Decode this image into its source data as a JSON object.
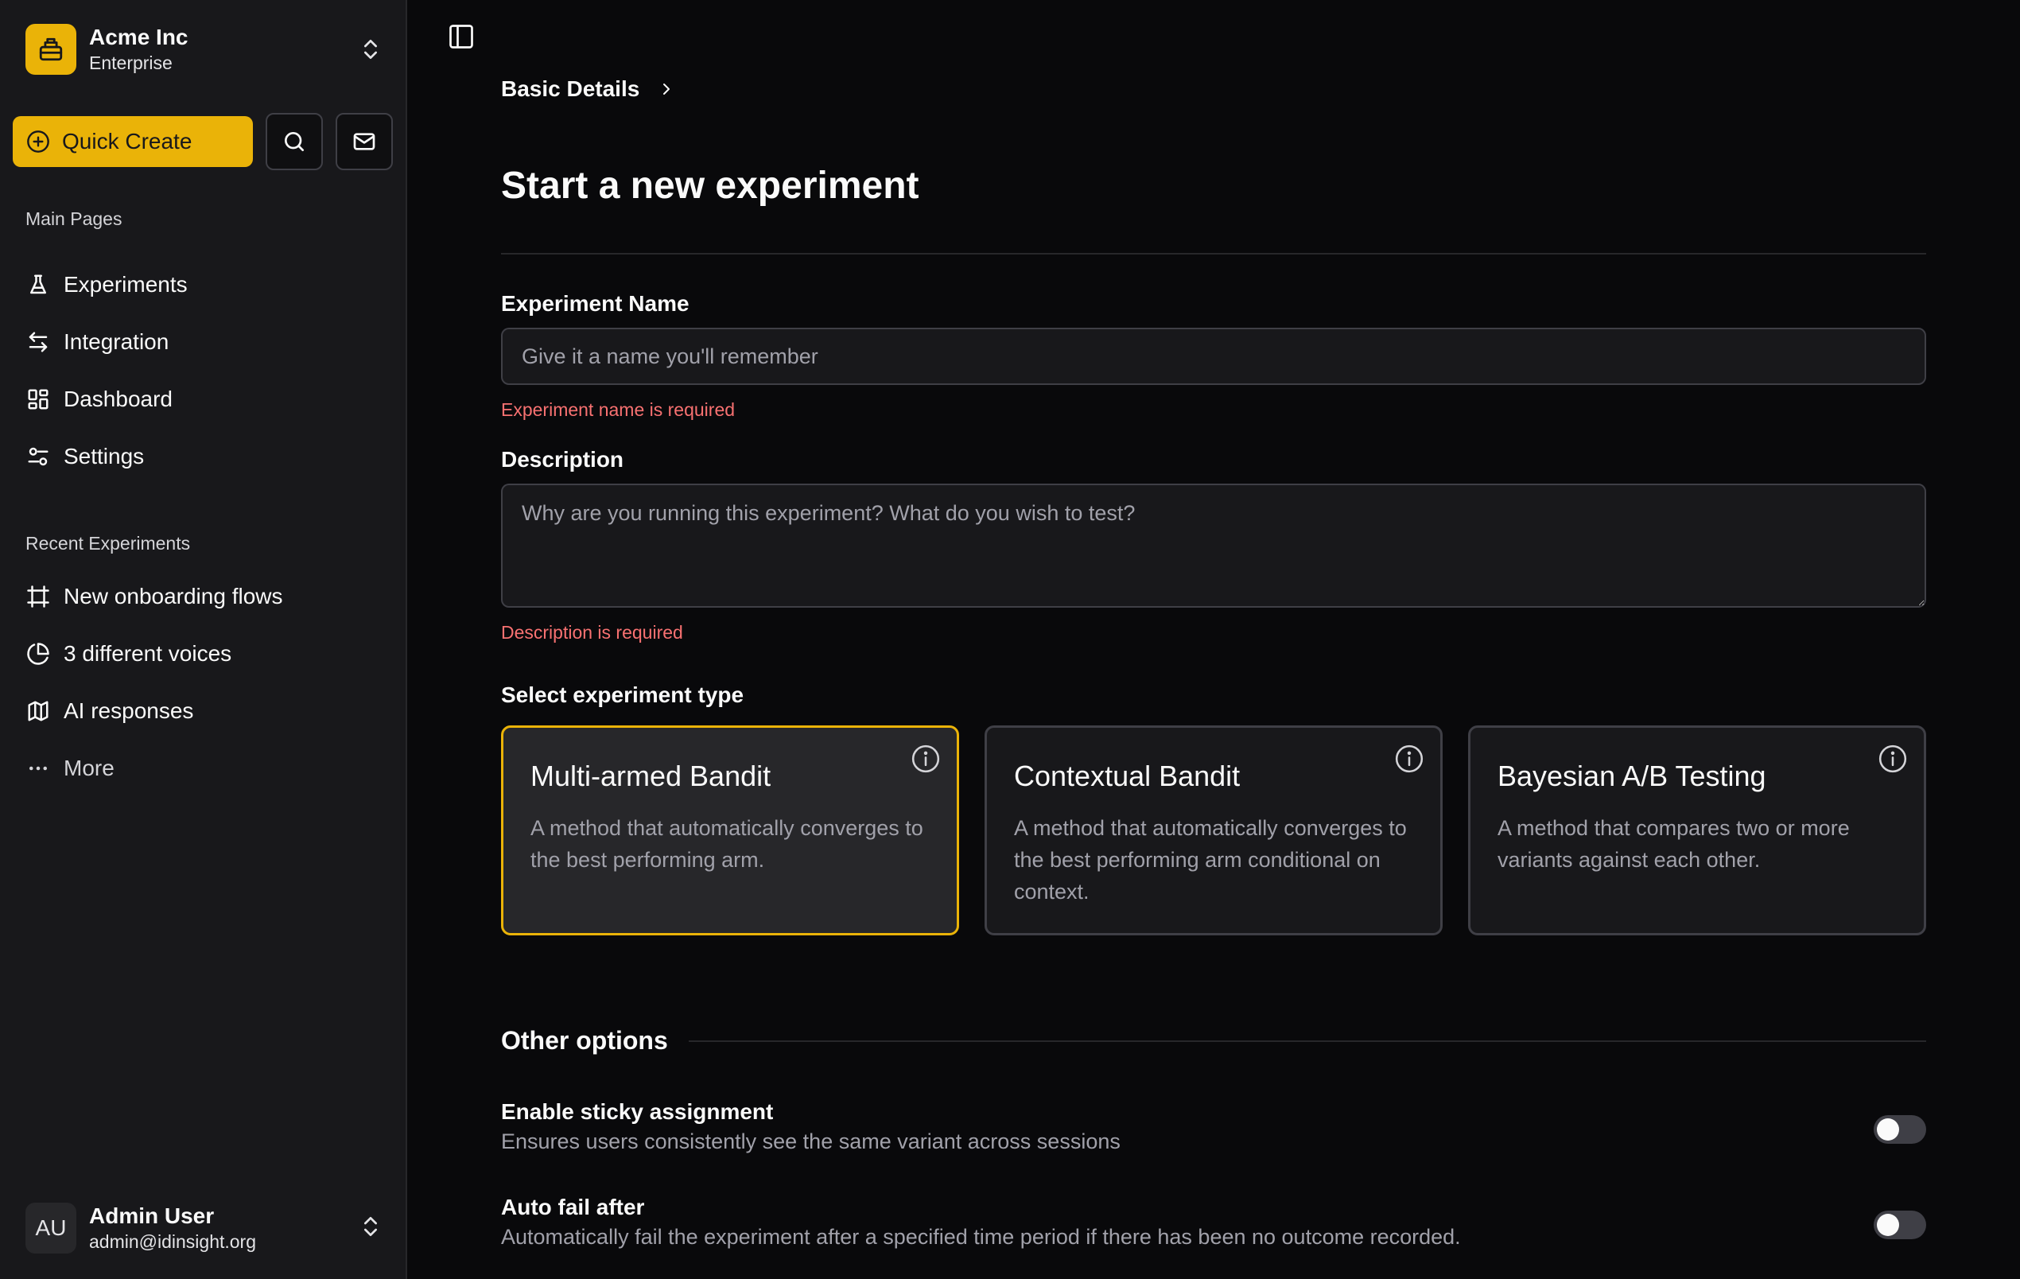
{
  "sidebar": {
    "org": {
      "name": "Acme Inc",
      "plan": "Enterprise"
    },
    "quick_create_label": "Quick Create",
    "main_section_label": "Main Pages",
    "main_items": [
      {
        "label": "Experiments",
        "icon": "flask-icon"
      },
      {
        "label": "Integration",
        "icon": "arrows-left-right-icon"
      },
      {
        "label": "Dashboard",
        "icon": "layout-dashboard-icon"
      },
      {
        "label": "Settings",
        "icon": "settings-sliders-icon"
      }
    ],
    "recent_section_label": "Recent Experiments",
    "recent_items": [
      {
        "label": "New onboarding flows",
        "icon": "frame-icon"
      },
      {
        "label": "3 different voices",
        "icon": "pie-chart-icon"
      },
      {
        "label": "AI responses",
        "icon": "map-icon"
      }
    ],
    "more_label": "More",
    "user": {
      "initials": "AU",
      "name": "Admin User",
      "email": "admin@idinsight.org"
    }
  },
  "main": {
    "breadcrumb": "Basic Details",
    "title": "Start a new experiment",
    "experiment_name": {
      "label": "Experiment Name",
      "value": "",
      "placeholder": "Give it a name you'll remember",
      "error": "Experiment name is required"
    },
    "description": {
      "label": "Description",
      "value": "",
      "placeholder": "Why are you running this experiment? What do you wish to test?",
      "error": "Description is required"
    },
    "experiment_type": {
      "label": "Select experiment type",
      "selected": "Multi-armed Bandit",
      "options": [
        {
          "title": "Multi-armed Bandit",
          "description": "A method that automatically converges to the best performing arm."
        },
        {
          "title": "Contextual Bandit",
          "description": "A method that automatically converges to the best performing arm conditional on context."
        },
        {
          "title": "Bayesian A/B Testing",
          "description": "A method that compares two or more variants against each other."
        }
      ]
    },
    "other_options": {
      "title": "Other options",
      "items": [
        {
          "title": "Enable sticky assignment",
          "description": "Ensures users consistently see the same variant across sessions",
          "enabled": false
        },
        {
          "title": "Auto fail after",
          "description": "Automatically fail the experiment after a specified time period if there has been no outcome recorded.",
          "enabled": false
        }
      ]
    }
  },
  "colors": {
    "accent": "#eab308",
    "background": "#09090b",
    "sidebar": "#18181b",
    "error": "#f87171"
  }
}
